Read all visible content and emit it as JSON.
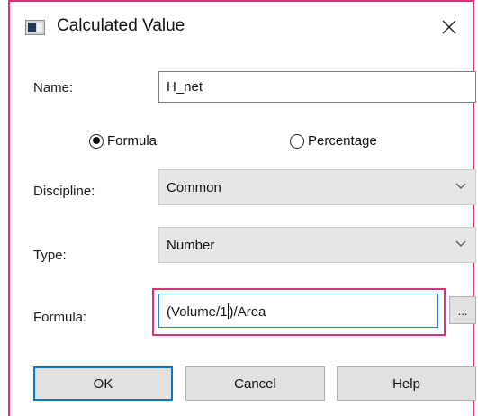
{
  "window": {
    "title": "Calculated Value",
    "icon": "calculated-value-app-icon",
    "close_icon": "close-icon"
  },
  "form": {
    "name_label": "Name:",
    "name_value": "H_net",
    "mode_options": [
      {
        "label": "Formula",
        "checked": true
      },
      {
        "label": "Percentage",
        "checked": false
      }
    ],
    "discipline_label": "Discipline:",
    "discipline_value": "Common",
    "type_label": "Type:",
    "type_value": "Number",
    "formula_label": "Formula:",
    "formula_before_caret": "(Volume/1",
    "formula_after_caret": ")/Area",
    "formula_browse_label": "..."
  },
  "buttons": {
    "ok": "OK",
    "cancel": "Cancel",
    "help": "Help"
  },
  "colors": {
    "highlight": "#e0307a",
    "focus": "#0078d7"
  }
}
